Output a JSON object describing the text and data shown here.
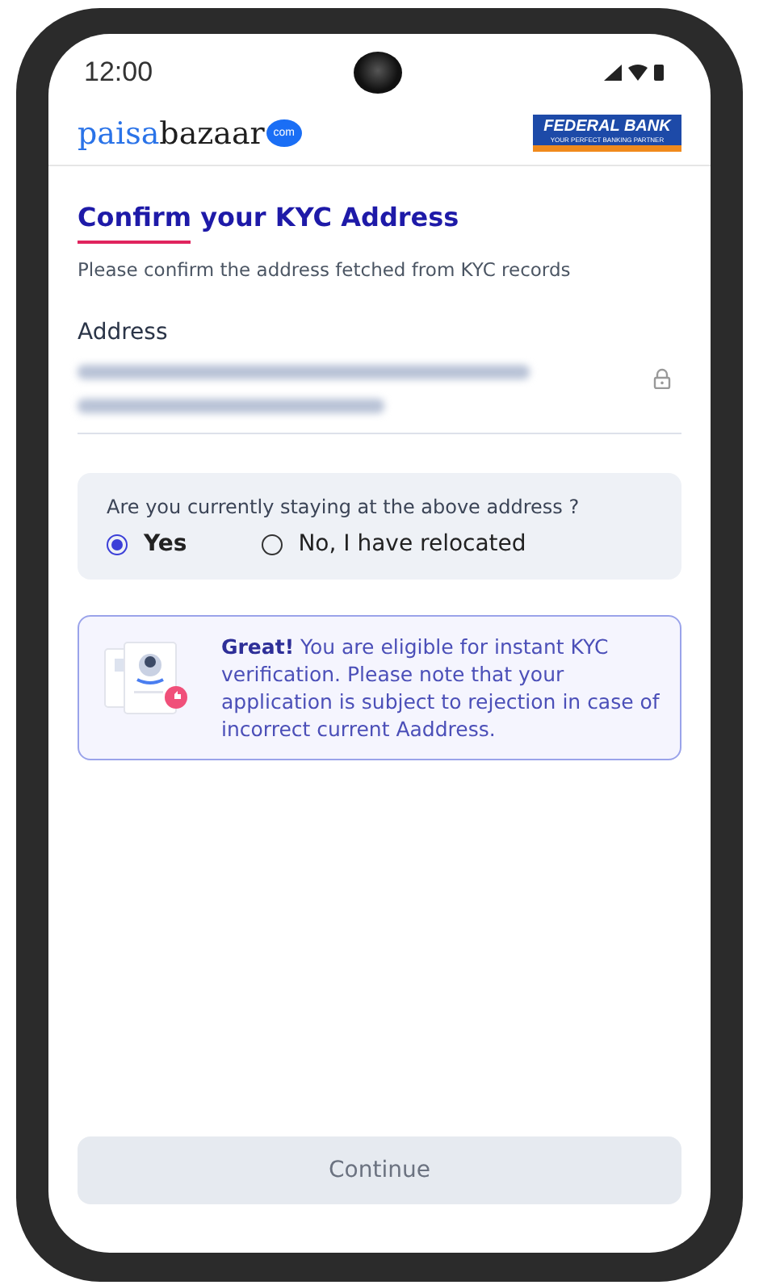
{
  "status_bar": {
    "time": "12:00"
  },
  "header": {
    "brand_logo": {
      "part_1": "paisa",
      "part_2": "bazaar",
      "badge": "com"
    },
    "partner_logo": {
      "name": "FEDERAL BANK",
      "tagline": "YOUR PERFECT BANKING PARTNER"
    }
  },
  "title": "Confirm your KYC Address",
  "subtitle": "Please confirm the address fetched from KYC records",
  "address_field": {
    "label": "Address",
    "locked": true
  },
  "question": {
    "text": "Are you currently staying at the above address ?",
    "options": [
      {
        "label": "Yes",
        "selected": true
      },
      {
        "label": "No, I have relocated",
        "selected": false
      }
    ]
  },
  "info": {
    "text": "**Great!** You are eligible for instant KYC verification. Please note that your application is subject to rejection in case of incorrect current Aaddress."
  },
  "continue_button": {
    "label": "Continue",
    "disabled": true
  }
}
